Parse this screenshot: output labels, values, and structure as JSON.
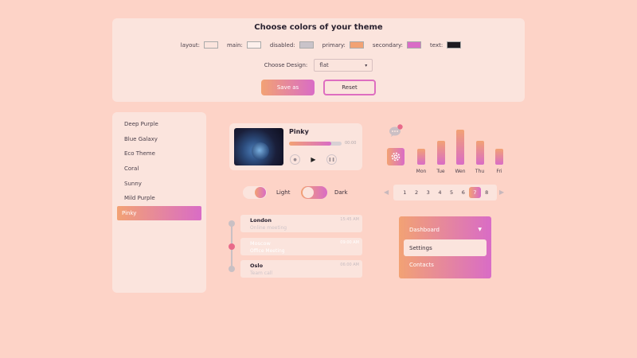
{
  "colors": {
    "background": "#fdd3c7",
    "panel": "#fbe4dd",
    "gradient_start": "#f2a274",
    "gradient_end": "#d96cc6"
  },
  "theme_panel": {
    "title": "Choose colors of your theme",
    "swatches": [
      {
        "label": "layout:",
        "color": "#fbe4dd"
      },
      {
        "label": "main:",
        "color": "#fdf0ec"
      },
      {
        "label": "disabled:",
        "color": "#c9c3c9"
      },
      {
        "label": "primary:",
        "color": "#f2a274"
      },
      {
        "label": "secondary:",
        "color": "#d96cc6"
      },
      {
        "label": "text:",
        "color": "#1e1a20"
      }
    ],
    "design_label": "Choose Design:",
    "design_value": "flat",
    "save_label": "Save as",
    "reset_label": "Reset"
  },
  "themes": {
    "items": [
      "Deep Purple",
      "Blue Galaxy",
      "Eco Theme",
      "Coral",
      "Sunny",
      "Mild Purple",
      "Pinky"
    ],
    "selected": "Pinky"
  },
  "player": {
    "title": "Pinky",
    "time": "00:00",
    "progress": 0.8,
    "prev_icon": "prev-icon",
    "play_icon": "play-icon",
    "next_icon": "next-icon"
  },
  "chart_data": {
    "type": "bar",
    "categories": [
      "Mon",
      "Tue",
      "Wen",
      "Thu",
      "Fri"
    ],
    "values": [
      20,
      30,
      44,
      30,
      20
    ],
    "ylim": [
      0,
      50
    ]
  },
  "toggles": {
    "light_label": "Light",
    "dark_label": "Dark"
  },
  "pagination": {
    "pages": [
      "1",
      "2",
      "3",
      "4",
      "5",
      "6",
      "7",
      "8"
    ],
    "active": "7"
  },
  "timeline": [
    {
      "city": "London",
      "sub": "Online meeting",
      "time": "15:45 AM",
      "active": false
    },
    {
      "city": "Moscow",
      "sub": "Office Meeting",
      "time": "09:00 AM",
      "active": true
    },
    {
      "city": "Oslo",
      "sub": "Team call",
      "time": "06:00 AM",
      "active": false
    }
  ],
  "menu": {
    "header": "Dashboard",
    "selected": "Settings",
    "item": "Contacts"
  }
}
